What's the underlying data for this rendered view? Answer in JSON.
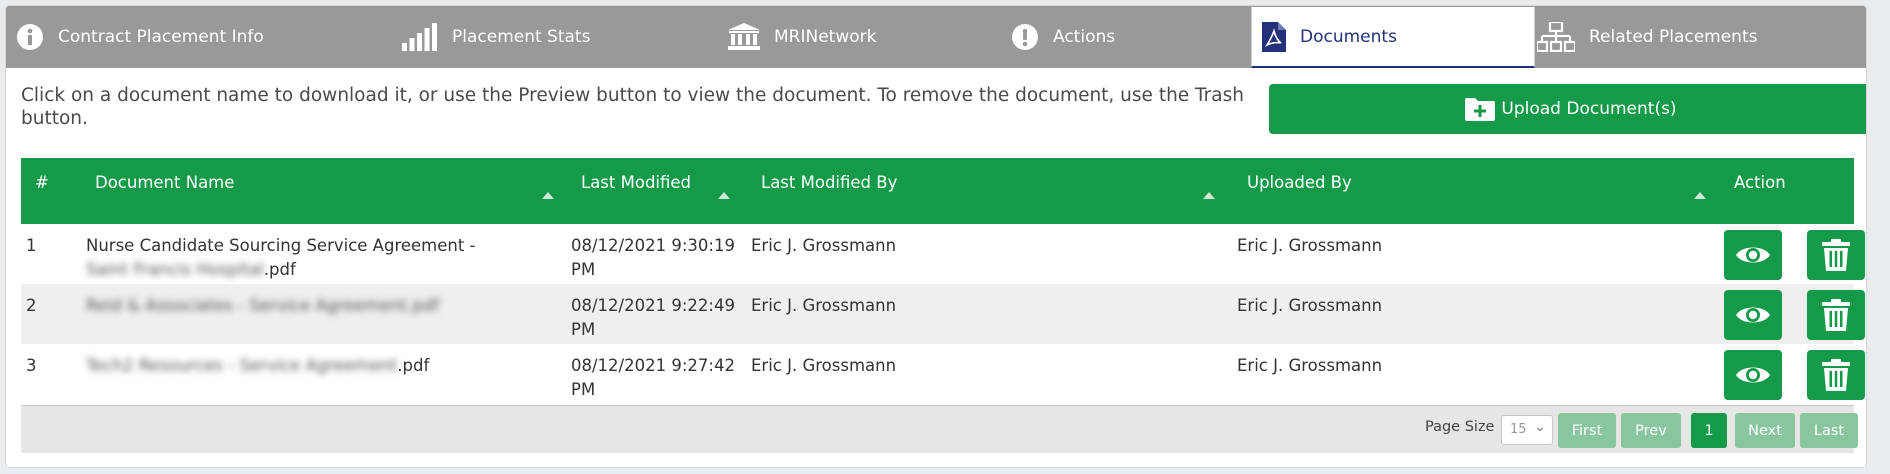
{
  "tabs": [
    {
      "label": "Contract Placement Info",
      "icon": "info-icon"
    },
    {
      "label": "Placement Stats",
      "icon": "signal-bars-icon"
    },
    {
      "label": "MRINetwork",
      "icon": "bank-icon"
    },
    {
      "label": "Actions",
      "icon": "exclamation-icon"
    },
    {
      "label": "Documents",
      "icon": "pdf-icon"
    },
    {
      "label": "Related Placements",
      "icon": "sitemap-icon"
    }
  ],
  "active_tab": "Documents",
  "colors": {
    "accent": "#149a48",
    "tab_bar": "#999999",
    "active_tab_text": "#22317a"
  },
  "intro_text": "Click on a document name to download it, or use the Preview button to view the document. To remove the document, use the Trash button.",
  "upload_button_label": "Upload Document(s)",
  "table": {
    "headers": [
      "#",
      "Document Name",
      "Last Modified",
      "Last Modified By",
      "Uploaded By",
      "Action"
    ],
    "rows": [
      {
        "num": "1",
        "name_prefix": "Nurse Candidate Sourcing Service Agreement - ",
        "name_blurred": "Saint Francis Hospital",
        "name_suffix": ".pdf",
        "last_modified": "08/12/2021 9:30:19 PM",
        "modified_by": "Eric J. Grossmann",
        "uploaded_by": "Eric J. Grossmann"
      },
      {
        "num": "2",
        "name_prefix": "",
        "name_blurred": "Reid & Associates - Service Agreement.pdf",
        "name_suffix": "",
        "last_modified": "08/12/2021 9:22:49 PM",
        "modified_by": "Eric J. Grossmann",
        "uploaded_by": "Eric J. Grossmann"
      },
      {
        "num": "3",
        "name_prefix": "",
        "name_blurred": "Tech2 Resources - Service Agreement",
        "name_suffix": ".pdf",
        "last_modified": "08/12/2021 9:27:42 PM",
        "modified_by": "Eric J. Grossmann",
        "uploaded_by": "Eric J. Grossmann"
      }
    ]
  },
  "pager": {
    "page_size_label": "Page Size",
    "page_size_value": "15",
    "first": "First",
    "prev": "Prev",
    "current_page": "1",
    "next": "Next",
    "last": "Last"
  }
}
